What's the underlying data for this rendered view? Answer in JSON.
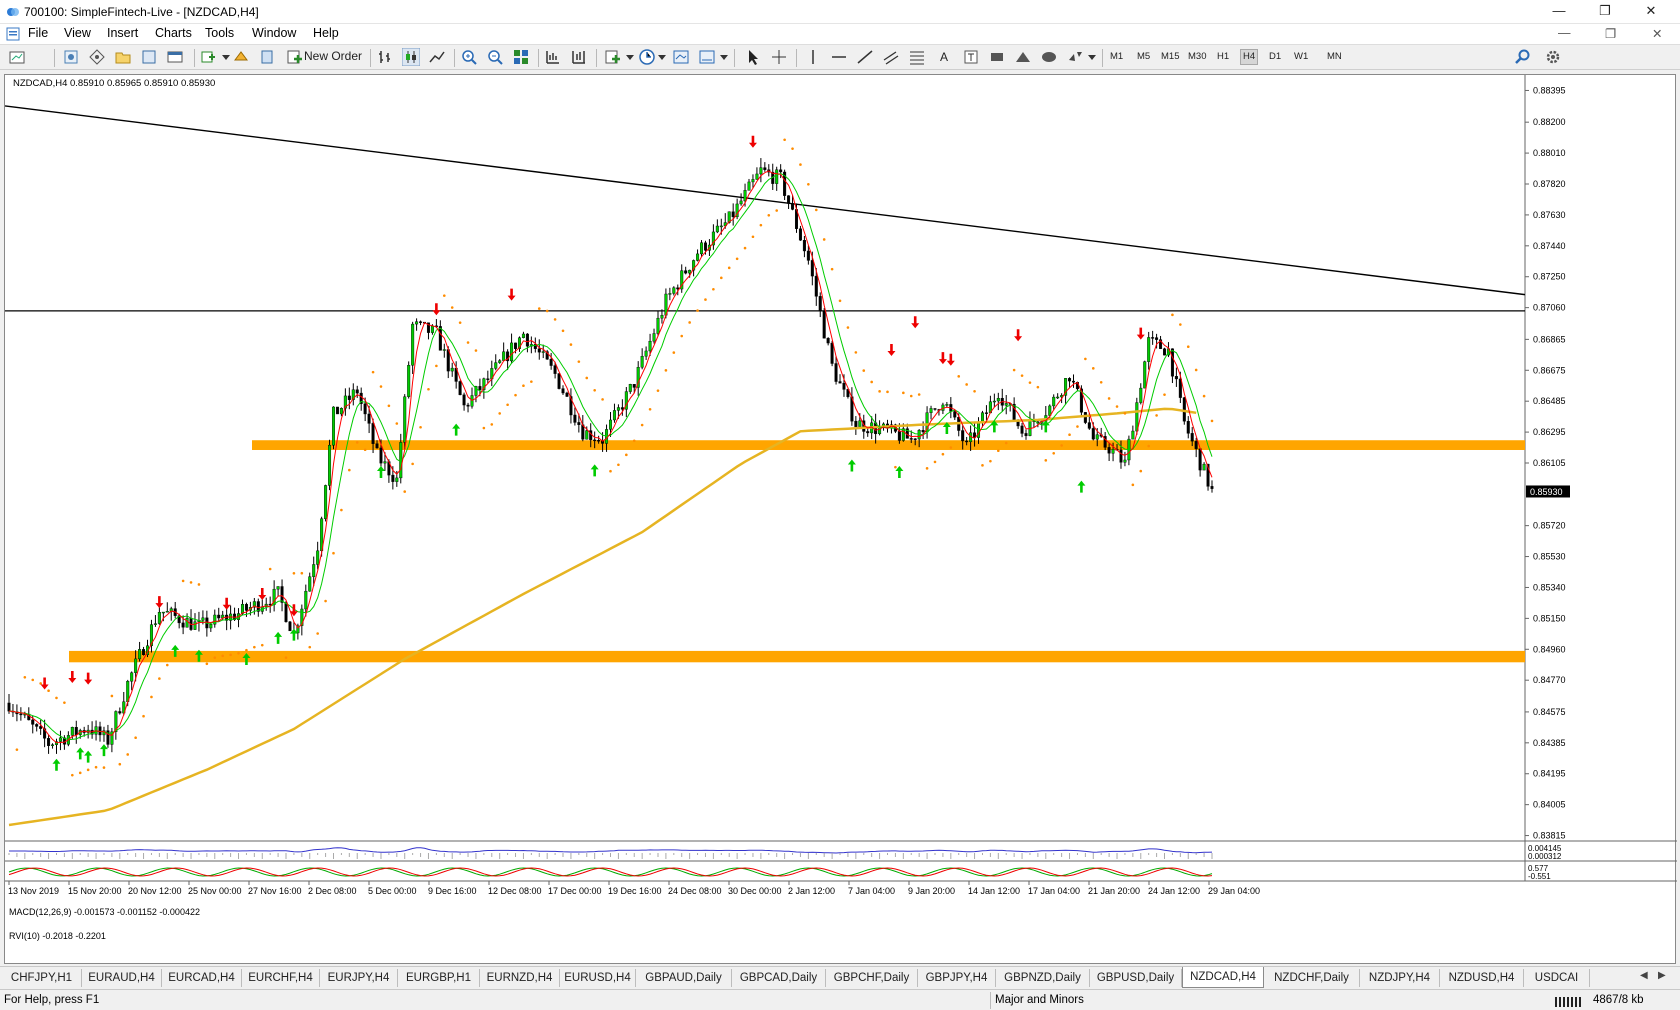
{
  "window": {
    "title": "700100: SimpleFintech-Live - [NZDCAD,H4]",
    "controls": [
      "—",
      "❐",
      "✕"
    ]
  },
  "menu": [
    "File",
    "View",
    "Insert",
    "Charts",
    "Tools",
    "Window",
    "Help"
  ],
  "toolbar": {
    "new_order_label": "New Order",
    "timeframes": [
      "M1",
      "M5",
      "M15",
      "M30",
      "H1",
      "H4",
      "D1",
      "W1",
      "MN"
    ],
    "selected_timeframe": "H4",
    "icons": [
      "new-chart-icon",
      "profiles-icon",
      "market-watch-icon",
      "navigator-icon",
      "data-window-icon",
      "terminal-icon",
      "strategy-tester-icon",
      "autotrading-icon",
      "bar-chart-icon",
      "candlestick-icon",
      "line-chart-icon",
      "zoom-in-icon",
      "zoom-out-icon",
      "tile-windows-icon",
      "autoscroll-icon",
      "chart-shift-icon",
      "indicators-icon",
      "periods-icon",
      "template-icon",
      "cursor-icon",
      "crosshair-icon",
      "vertical-line-icon",
      "horizontal-line-icon",
      "trendline-icon",
      "equidistant-channel-icon",
      "fibonacci-icon",
      "text-icon",
      "text-label-icon",
      "rectangle-icon",
      "triangle-icon",
      "ellipse-icon",
      "arrows-icon",
      "search-icon",
      "settings-icon"
    ]
  },
  "chart": {
    "symbol_line": "NZDCAD,H4  0.85910 0.85965 0.85910 0.85930",
    "current_price": "0.85930",
    "price_labels": [
      "0.88395",
      "0.88200",
      "0.88010",
      "0.87820",
      "0.87630",
      "0.87440",
      "0.87250",
      "0.87060",
      "0.86865",
      "0.86675",
      "0.86485",
      "0.86295",
      "0.86105",
      "0.85720",
      "0.85530",
      "0.85340",
      "0.85150",
      "0.84960",
      "0.84770",
      "0.84575",
      "0.84385",
      "0.84195",
      "0.84005",
      "0.83815"
    ],
    "date_labels": [
      "13 Nov 2019",
      "15 Nov 20:00",
      "20 Nov 12:00",
      "25 Nov 00:00",
      "27 Nov 16:00",
      "2 Dec 08:00",
      "5 Dec 00:00",
      "9 Dec 16:00",
      "12 Dec 08:00",
      "17 Dec 00:00",
      "19 Dec 16:00",
      "24 Dec 08:00",
      "30 Dec 00:00",
      "2 Jan 12:00",
      "7 Jan 04:00",
      "9 Jan 20:00",
      "14 Jan 12:00",
      "17 Jan 04:00",
      "21 Jan 20:00",
      "24 Jan 12:00",
      "29 Jan 04:00"
    ],
    "macd_label": "MACD(12,26,9) -0.001573 -0.001152 -0.000422",
    "macd_scale": [
      "0.004145",
      "0.000312"
    ],
    "rvi_label": "RVI(10) -0.2018 -0.2201",
    "rvi_scale": [
      "0.577",
      "-0.551"
    ],
    "colors": {
      "support_zone": "#ffa500",
      "ma_slow": "#e6b422",
      "ma_fast_green": "#00cc00",
      "ma_fast_red": "#ff0000",
      "sar": "#ff8c00",
      "arrow_up": "#00cc00",
      "arrow_down": "#ee0000"
    }
  },
  "tabs": [
    "CHFJPY,H1",
    "EURAUD,H4",
    "EURCAD,H4",
    "EURCHF,H4",
    "EURJPY,H4",
    "EURGBP,H1",
    "EURNZD,H4",
    "EURUSD,H4",
    "GBPAUD,Daily",
    "GBPCAD,Daily",
    "GBPCHF,Daily",
    "GBPJPY,H4",
    "GBPNZD,Daily",
    "GBPUSD,Daily",
    "NZDCAD,H4",
    "NZDCHF,Daily",
    "NZDJPY,H4",
    "NZDUSD,H4",
    "USDCAI"
  ],
  "active_tab": "NZDCAD,H4",
  "status": {
    "help": "For Help, press F1",
    "profile": "Major and Minors",
    "traffic": "4867/8 kb"
  }
}
